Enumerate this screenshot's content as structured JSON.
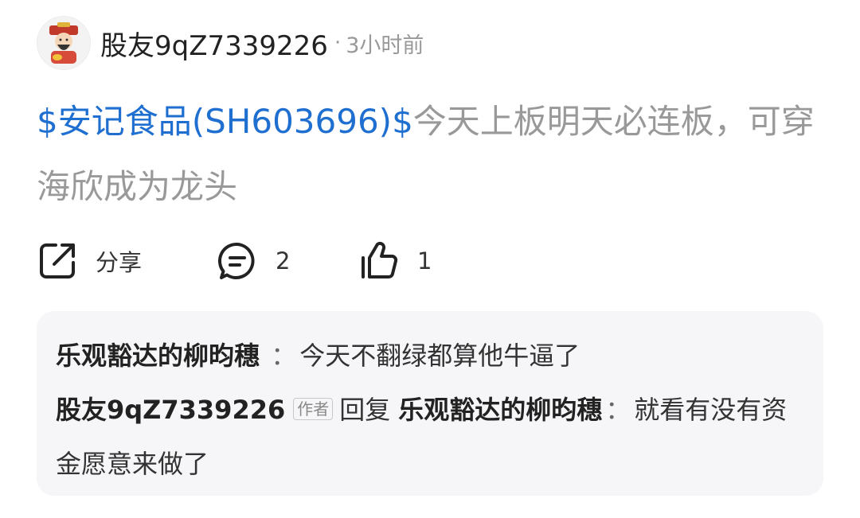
{
  "author": {
    "name": "股友9qZ7339226",
    "time": "3小时前",
    "separator": "·"
  },
  "post": {
    "stock_link": "$安记食品(SH603696)$",
    "text": "今天上板明天必连板，可穿海欣成为龙头"
  },
  "actions": {
    "share_label": "分享",
    "comment_count": "2",
    "like_count": "1"
  },
  "comments": [
    {
      "name": "乐观豁达的柳昀穗",
      "separator": "：",
      "text": "今天不翻绿都算他牛逼了"
    },
    {
      "name": "股友9qZ7339226",
      "badge": "作者",
      "reply_word": "回复",
      "reply_to": "乐观豁达的柳昀穗",
      "separator": "：",
      "text": "就看有没有资金愿意来做了"
    }
  ],
  "colors": {
    "link": "#1f6fd1",
    "muted": "#999999",
    "panel": "#f6f6f8"
  }
}
